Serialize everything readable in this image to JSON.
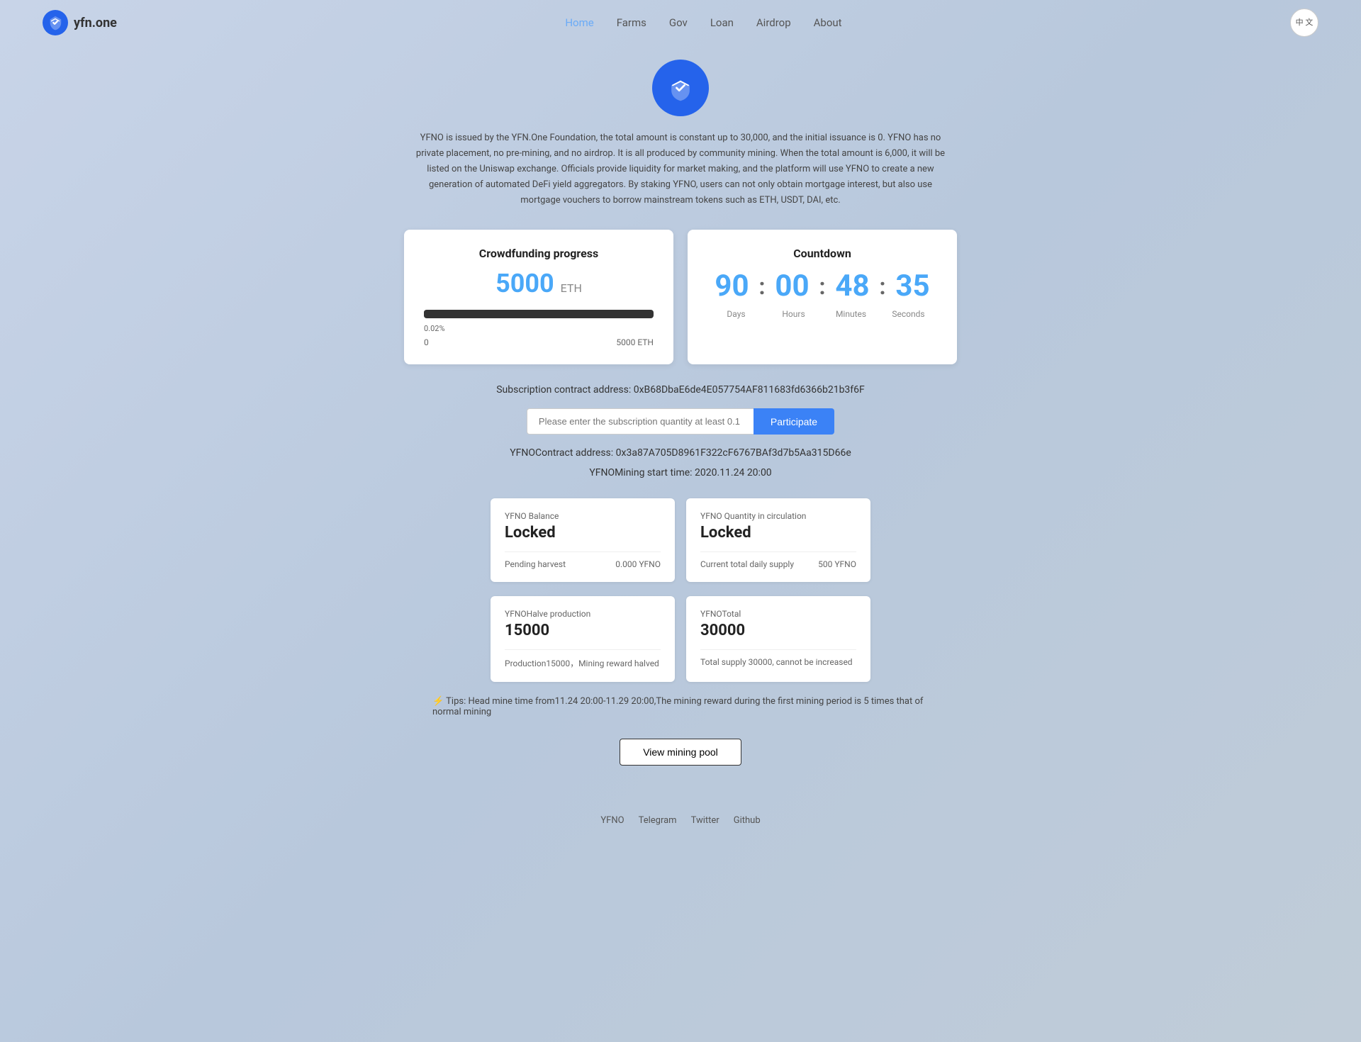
{
  "nav": {
    "logo_text": "yfn.one",
    "links": [
      {
        "label": "Home",
        "active": true
      },
      {
        "label": "Farms",
        "active": false
      },
      {
        "label": "Gov",
        "active": false
      },
      {
        "label": "Loan",
        "active": false
      },
      {
        "label": "Airdrop",
        "active": false
      },
      {
        "label": "About",
        "active": false
      }
    ],
    "lang_button": "中\n文"
  },
  "hero": {
    "description": "YFNO is issued by the YFN.One Foundation, the total amount is constant up to 30,000, and the initial issuance is 0. YFNO has no private placement, no pre-mining, and no airdrop. It is all produced by community mining. When the total amount is 6,000, it will be listed on the Uniswap exchange. Officials provide liquidity for market making, and the platform will use YFNO to create a new generation of automated DeFi yield aggregators. By staking YFNO, users can not only obtain mortgage interest, but also use mortgage vouchers to borrow mainstream tokens such as ETH, USDT, DAI, etc."
  },
  "crowdfunding": {
    "title": "Crowdfunding progress",
    "amount": "5000",
    "unit": "ETH",
    "progress_percent": "0.02%",
    "progress_width": "1%",
    "label_left": "0",
    "label_right": "5000 ETH"
  },
  "countdown": {
    "title": "Countdown",
    "days": "90",
    "hours": "00",
    "minutes": "48",
    "seconds": "35",
    "label_days": "Days",
    "label_hours": "Hours",
    "label_minutes": "Minutes",
    "label_seconds": "Seconds"
  },
  "subscription": {
    "contract_label": "Subscription contract address:",
    "contract_address": "0xB68DbaE6de4E057754AF811683fd6366b21b3f6F",
    "input_placeholder": "Please enter the subscription quantity at least 0.1",
    "participate_label": "Participate"
  },
  "yfno_contract": {
    "label": "YFNOContract address:",
    "address": "0x3a87A705D8961F322cF6767BAf3d7b5Aa315D66e"
  },
  "mining": {
    "start_label": "YFNOMining start time: 2020.11.24 20:00"
  },
  "balance_card": {
    "label": "YFNO Balance",
    "value": "Locked",
    "detail_label": "Pending harvest",
    "detail_value": "0.000 YFNO"
  },
  "circulation_card": {
    "label": "YFNO Quantity in circulation",
    "value": "Locked",
    "detail_label": "Current total daily supply",
    "detail_value": "500 YFNO"
  },
  "halve_card": {
    "label": "YFNOHalve production",
    "value": "15000",
    "detail_text": "Production15000，Mining reward halved"
  },
  "total_card": {
    "label": "YFNOTotal",
    "value": "30000",
    "detail_text": "Total supply 30000, cannot be increased"
  },
  "tips": {
    "icon": "⚡",
    "text": "Tips: Head mine time from11.24 20:00-11.29 20:00,The mining reward during the first mining period is 5 times that of normal mining"
  },
  "view_pool": {
    "label": "View mining pool"
  },
  "footer": {
    "links": [
      "YFNO",
      "Telegram",
      "Twitter",
      "Github"
    ]
  }
}
